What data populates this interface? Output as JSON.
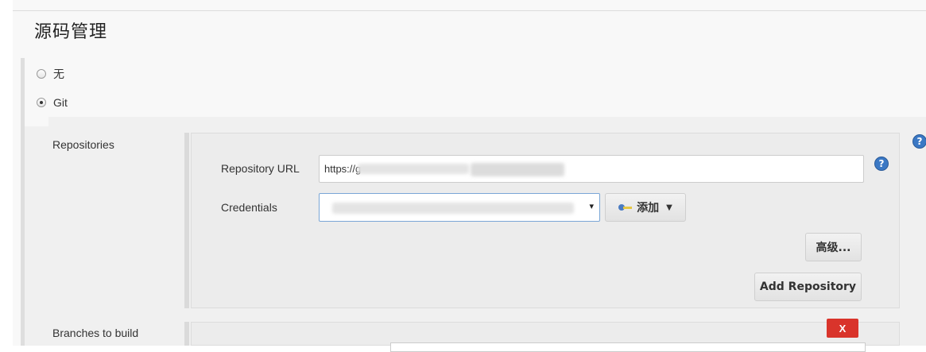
{
  "section": {
    "title": "源码管理"
  },
  "scm": {
    "options": [
      {
        "label": "无",
        "checked": false
      },
      {
        "label": "Git",
        "checked": true
      }
    ]
  },
  "repositories": {
    "label": "Repositories",
    "url_label": "Repository URL",
    "url_value": "https://g",
    "credentials_label": "Credentials",
    "credentials_arrow": "▾",
    "add_button": "添加",
    "advanced_button": "高级...",
    "add_repo_button": "Add Repository"
  },
  "branches": {
    "label": "Branches to build",
    "delete_button": "X"
  },
  "help": {
    "glyph": "?"
  },
  "colors": {
    "accent": "#3b78c4",
    "danger": "#d9342b",
    "focus_border": "#7aa6d6"
  }
}
